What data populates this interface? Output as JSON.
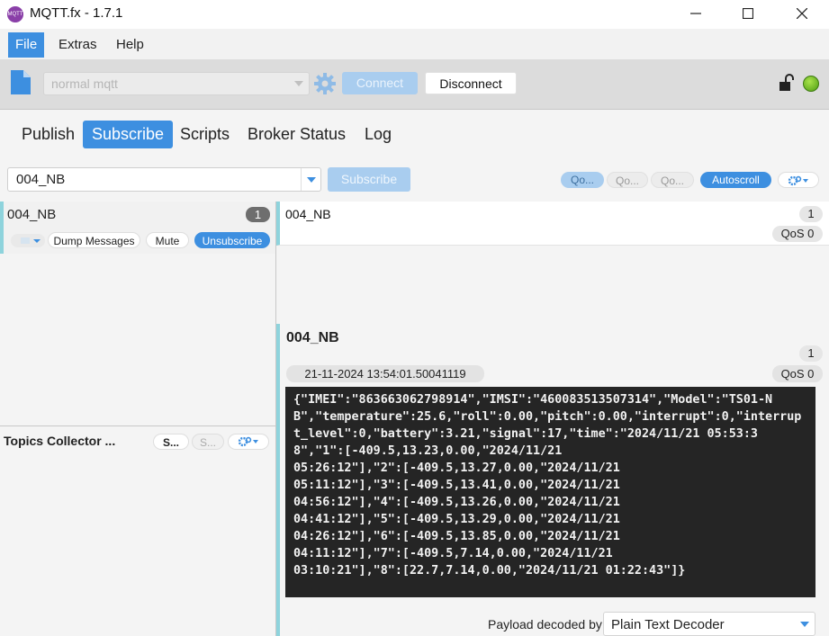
{
  "window": {
    "title": "MQTT.fx - 1.7.1",
    "app_icon_text": "MQTT"
  },
  "menu": {
    "items": [
      "File",
      "Extras",
      "Help"
    ]
  },
  "toolbar": {
    "profile_placeholder": "normal mqtt",
    "connect_label": "Connect",
    "disconnect_label": "Disconnect",
    "status_color": "#6cbf1a"
  },
  "tabs": [
    "Publish",
    "Subscribe",
    "Scripts",
    "Broker Status",
    "Log"
  ],
  "subscribe": {
    "topic_value": "004_NB",
    "subscribe_label": "Subscribe",
    "qos_buttons": [
      "Qo...",
      "Qo...",
      "Qo..."
    ],
    "autoscroll_label": "Autoscroll"
  },
  "subscription": {
    "topic": "004_NB",
    "count": "1",
    "dump_label": "Dump Messages",
    "mute_label": "Mute",
    "unsubscribe_label": "Unsubscribe"
  },
  "topics_collector": {
    "title": "Topics Collector ...",
    "scan_label": "S...",
    "stop_label": "S..."
  },
  "message_list": [
    {
      "topic": "004_NB",
      "index": "1",
      "qos": "QoS 0"
    }
  ],
  "detail": {
    "topic": "004_NB",
    "index": "1",
    "timestamp": "21-11-2024  13:54:01.50041119",
    "qos": "QoS 0",
    "payload": "{\"IMEI\":\"863663062798914\",\"IMSI\":\"460083513507314\",\"Model\":\"TS01-NB\",\"temperature\":25.6,\"roll\":0.00,\"pitch\":0.00,\"interrupt\":0,\"interrupt_level\":0,\"battery\":3.21,\"signal\":17,\"time\":\"2024/11/21 05:53:38\",\"1\":[-409.5,13.23,0.00,\"2024/11/21\n05:26:12\"],\"2\":[-409.5,13.27,0.00,\"2024/11/21\n05:11:12\"],\"3\":[-409.5,13.41,0.00,\"2024/11/21\n04:56:12\"],\"4\":[-409.5,13.26,0.00,\"2024/11/21\n04:41:12\"],\"5\":[-409.5,13.29,0.00,\"2024/11/21\n04:26:12\"],\"6\":[-409.5,13.85,0.00,\"2024/11/21\n04:11:12\"],\"7\":[-409.5,7.14,0.00,\"2024/11/21\n03:10:21\"],\"8\":[22.7,7.14,0.00,\"2024/11/21 01:22:43\"]}",
    "decoder_label": "Payload decoded by",
    "decoder_value": "Plain Text Decoder"
  },
  "colors": {
    "accent": "#3d8fe0",
    "accent_disabled": "#a9cdef",
    "card_stripe": "#8ed3dc",
    "payload_bg": "#252525"
  }
}
